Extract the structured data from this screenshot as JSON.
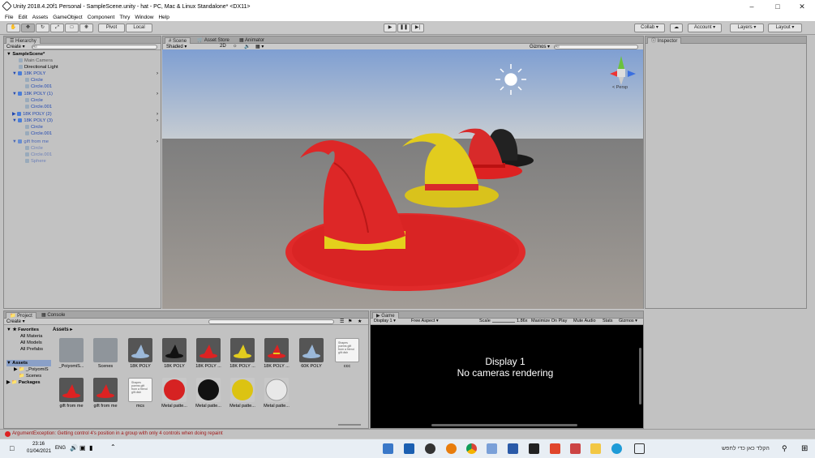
{
  "window": {
    "title": "Unity 2018.4.20f1 Personal - SampleScene.unity - hat - PC, Mac & Linux Standalone* <DX11>"
  },
  "menu": [
    "File",
    "Edit",
    "Assets",
    "GameObject",
    "Component",
    "Thry",
    "Window",
    "Help"
  ],
  "toolbar": {
    "pivot": "Pivot",
    "local": "Local",
    "collab": "Collab",
    "account": "Account",
    "layers": "Layers",
    "layout": "Layout"
  },
  "hierarchy": {
    "tab": "Hierarchy",
    "create": "Create",
    "search_placeholder": "All",
    "scene": "SampleScene*",
    "items": [
      "Main Camera",
      "Directional Light",
      "18K POLY",
      "Circle",
      "Circle.001",
      "18K POLY (1)",
      "Circle",
      "Circle.001",
      "18K POLY (2)",
      "18K POLY (3)",
      "Circle",
      "Circle.001",
      "gift from me",
      "Circle",
      "Circle.001",
      "Sphere"
    ]
  },
  "scene": {
    "tabs": [
      "Scene",
      "Asset Store",
      "Animator"
    ],
    "shading": "Shaded",
    "mode2d": "2D",
    "gizmos": "Gizmos",
    "search_placeholder": "All",
    "persp": "< Persp"
  },
  "inspector": {
    "tab": "Inspector"
  },
  "project": {
    "tabs": [
      "Project",
      "Console"
    ],
    "create": "Create",
    "breadcrumb": "Assets",
    "favorites": "Favorites",
    "fav_items": [
      "All Materia",
      "All Models",
      "All Prefabs"
    ],
    "assets_label": "Assets",
    "asset_folders": [
      "_PoiyomiS",
      "Scenes"
    ],
    "packages": "Packages",
    "grid": [
      "_PoiyomiS...",
      "Scenes",
      "18K POLY",
      "18K POLY",
      "18K POLY ...",
      "18K POLY ...",
      "18K POLY ...",
      "60K POLY",
      "ccc",
      "gift from me",
      "gift from me",
      "mcs",
      "Metal patte...",
      "Metal patte...",
      "Metal patte...",
      "Metal patte..."
    ],
    "doc_text": "Shapes poems gift from a friend gift dish"
  },
  "game": {
    "tab": "Game",
    "display": "Display 1",
    "aspect": "Free Aspect",
    "scale_label": "Scale",
    "scale_value": "1.86x",
    "maximize": "Maximize On Play",
    "mute": "Mute Audio",
    "stats": "Stats",
    "gizmos": "Gizmos",
    "msg1": "Display 1",
    "msg2": "No cameras rendering"
  },
  "status": {
    "error": "ArgumentException: Getting control 4's position in a group with only 4 controls when doing repaint"
  },
  "taskbar": {
    "time": "23:16",
    "date": "01/04/2021",
    "lang": "ENG",
    "search": "הקלד כאן כדי לחפש"
  },
  "colors": {
    "red": "#e02a2a",
    "yellow": "#e8d21c",
    "black": "#1a1a1a",
    "sky": "#8aa7d6",
    "ground": "#9a9a9a"
  }
}
